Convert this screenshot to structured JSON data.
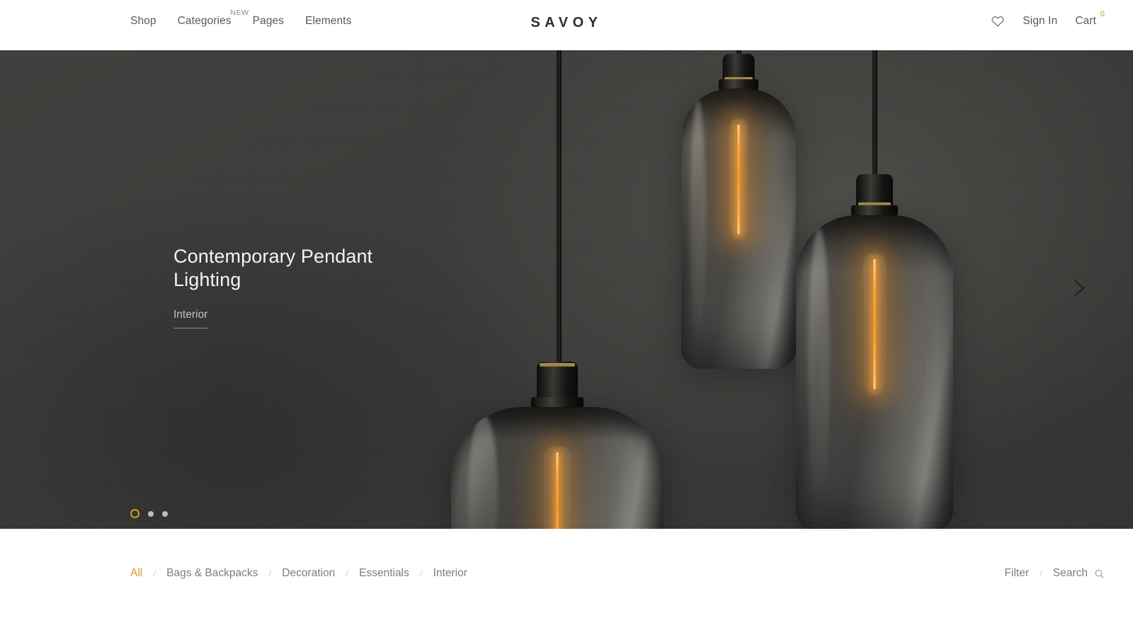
{
  "header": {
    "brand": "SAVOY",
    "nav": [
      {
        "label": "Shop",
        "badge": ""
      },
      {
        "label": "Categories",
        "badge": "NEW"
      },
      {
        "label": "Pages",
        "badge": ""
      },
      {
        "label": "Elements",
        "badge": ""
      }
    ],
    "wishlist_icon": "heart-icon",
    "sign_in": "Sign In",
    "cart": "Cart",
    "cart_count": "0",
    "accent_color": "#c79a3c"
  },
  "hero": {
    "title": "Contemporary Pendant Lighting",
    "subtitle": "Interior",
    "next_icon": "chevron-right-icon",
    "background_color": "#3e3e3c",
    "slides": [
      {
        "active": true
      },
      {
        "active": false
      },
      {
        "active": false
      }
    ],
    "active_dot_color": "#d79b23"
  },
  "filter_bar": {
    "categories": [
      {
        "label": "All",
        "active": true
      },
      {
        "label": "Bags & Backpacks",
        "active": false
      },
      {
        "label": "Decoration",
        "active": false
      },
      {
        "label": "Essentials",
        "active": false
      },
      {
        "label": "Interior",
        "active": false
      }
    ],
    "separator": "/",
    "filter_label": "Filter",
    "search_label": "Search",
    "search_icon": "magnifier-icon",
    "active_color": "#d79b23"
  }
}
